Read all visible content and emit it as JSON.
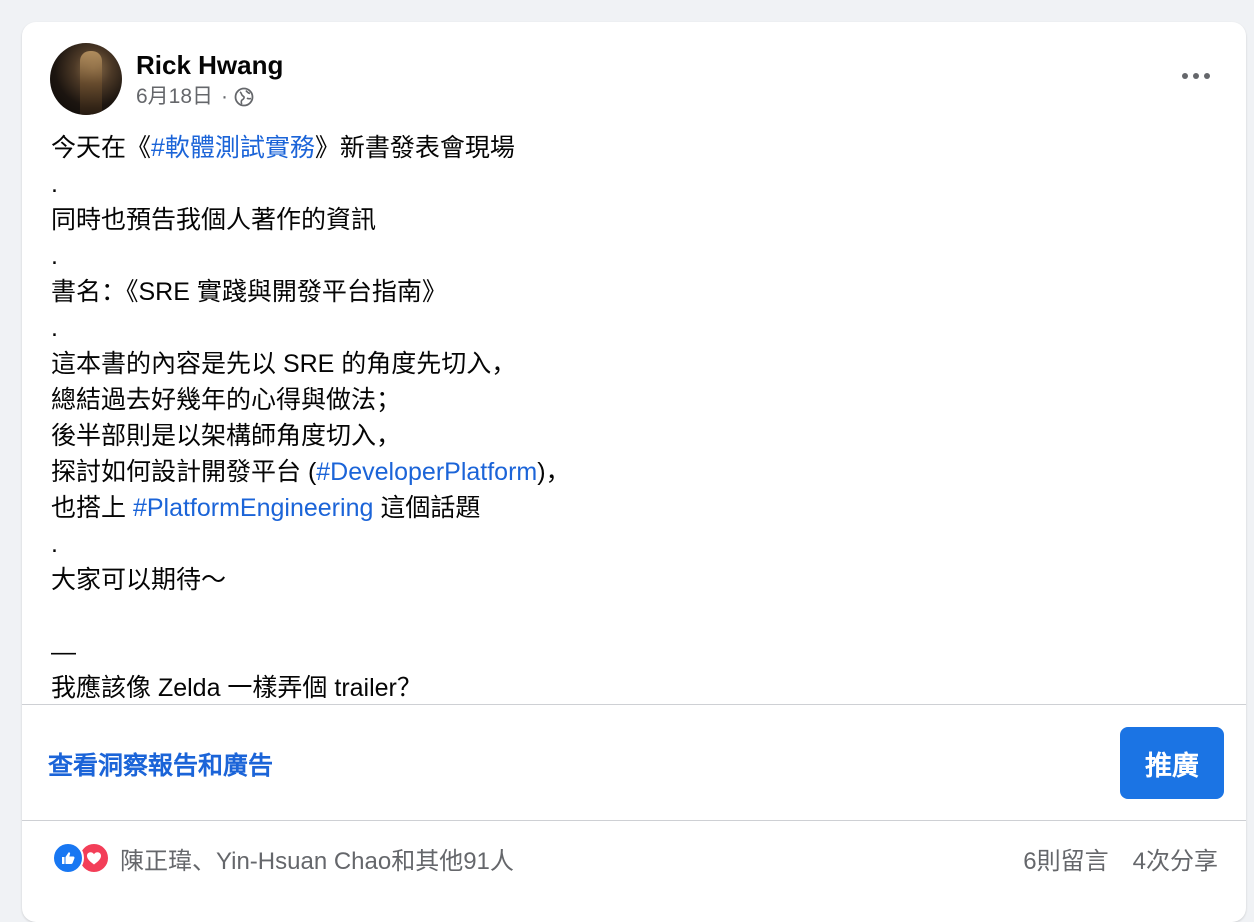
{
  "post": {
    "author": "Rick Hwang",
    "date": "6月18日",
    "separator": "·",
    "privacy_icon": "globe-icon",
    "lines": [
      [
        {
          "t": "今天在《",
          "tag": false
        },
        {
          "t": "#軟體測試實務",
          "tag": true
        },
        {
          "t": "》新書發表會現場",
          "tag": false
        }
      ],
      [
        {
          "t": ".",
          "tag": false
        }
      ],
      [
        {
          "t": "同時也預告我個人著作的資訊",
          "tag": false
        }
      ],
      [
        {
          "t": ".",
          "tag": false
        }
      ],
      [
        {
          "t": "書名：《SRE 實踐與開發平台指南》",
          "tag": false
        }
      ],
      [
        {
          "t": ".",
          "tag": false
        }
      ],
      [
        {
          "t": "這本書的內容是先以 SRE 的角度先切入，",
          "tag": false
        }
      ],
      [
        {
          "t": "總結過去好幾年的心得與做法；",
          "tag": false
        }
      ],
      [
        {
          "t": "後半部則是以架構師角度切入，",
          "tag": false
        }
      ],
      [
        {
          "t": "探討如何設計開發平台 (",
          "tag": false
        },
        {
          "t": "#DeveloperPlatform",
          "tag": true
        },
        {
          "t": ")，",
          "tag": false
        }
      ],
      [
        {
          "t": "也搭上 ",
          "tag": false
        },
        {
          "t": "#PlatformEngineering",
          "tag": true
        },
        {
          "t": " 這個話題",
          "tag": false
        }
      ],
      [
        {
          "t": ".",
          "tag": false
        }
      ],
      [
        {
          "t": "大家可以期待～",
          "tag": false
        }
      ],
      [
        {
          "t": "",
          "tag": false
        }
      ],
      [
        {
          "t": "—",
          "tag": false
        }
      ],
      [
        {
          "t": "我應該像 Zelda 一樣弄個 trailer？",
          "tag": false
        }
      ]
    ]
  },
  "actions": {
    "insights_label": "查看洞察報告和廣告",
    "promote_label": "推廣"
  },
  "footer": {
    "reaction_icons": [
      "like-icon",
      "love-icon"
    ],
    "reacted_by": "陳正瑋、Yin-Hsuan Chao和其他91人",
    "comments": "6則留言",
    "shares": "4次分享"
  },
  "colors": {
    "link": "#1b64d8",
    "promote_bg": "#1b74e4",
    "like": "#1877f2",
    "love": "#f33e58",
    "secondary_text": "#65676b"
  }
}
